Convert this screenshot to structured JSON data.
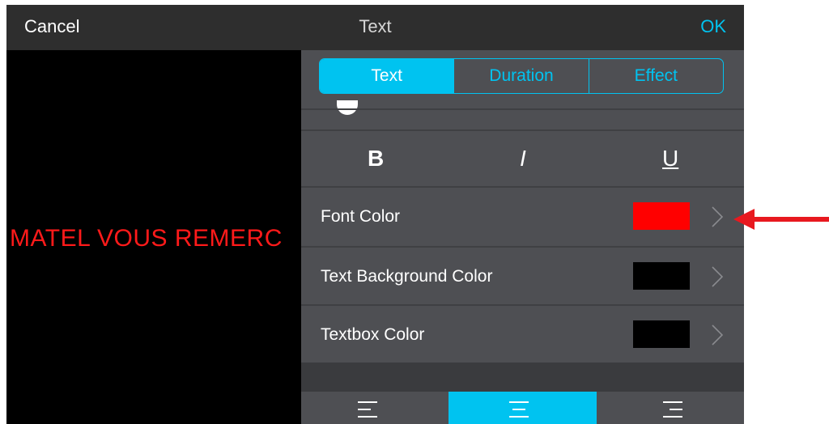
{
  "topbar": {
    "cancel_label": "Cancel",
    "title": "Text",
    "ok_label": "OK"
  },
  "preview": {
    "caption": "MATEL VOUS REMERC"
  },
  "tabs": [
    {
      "label": "Text",
      "active": true
    },
    {
      "label": "Duration",
      "active": false
    },
    {
      "label": "Effect",
      "active": false
    }
  ],
  "style_buttons": {
    "bold": "B",
    "italic": "I",
    "underline": "U"
  },
  "color_rows": [
    {
      "label": "Font Color",
      "swatch": "#ff0000"
    },
    {
      "label": "Text Background Color",
      "swatch": "#000000"
    },
    {
      "label": "Textbox Color",
      "swatch": "#000000"
    }
  ],
  "alignment": {
    "options": [
      "align-left",
      "align-center",
      "align-right"
    ],
    "selected": "align-center"
  },
  "colors": {
    "accent": "#00c3f0",
    "panel": "#4e4f53",
    "topbar": "#2e2e2e",
    "caption": "#ff1a1a",
    "annotation_arrow": "#e8191f"
  }
}
